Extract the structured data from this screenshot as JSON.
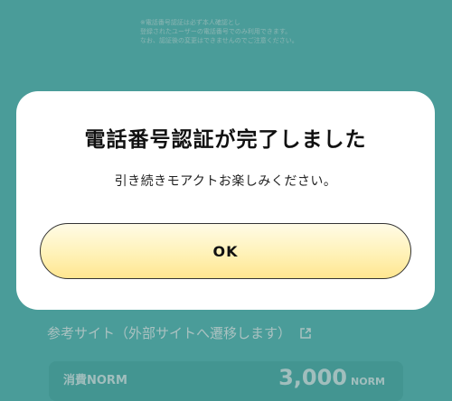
{
  "background": {
    "note_lines": [
      "※電話番号認証は必ず本人確認とし",
      "登録されたユーザーの電話番号でのみ利用できます。",
      "なお、認証後の変更はできませんのでご注意ください。"
    ],
    "reference_link_label": "参考サイト（外部サイトへ遷移します）",
    "cost_row": {
      "label": "消費NORM",
      "value": "3,000",
      "unit": "NORM"
    }
  },
  "modal": {
    "title": "電話番号認証が完了しました",
    "message": "引き続きモアクトお楽しみください。",
    "ok_label": "OK"
  },
  "colors": {
    "background": "#5cc1bc",
    "button_gradient_top": "#fffbe6",
    "button_gradient_bottom": "#ffe690"
  }
}
